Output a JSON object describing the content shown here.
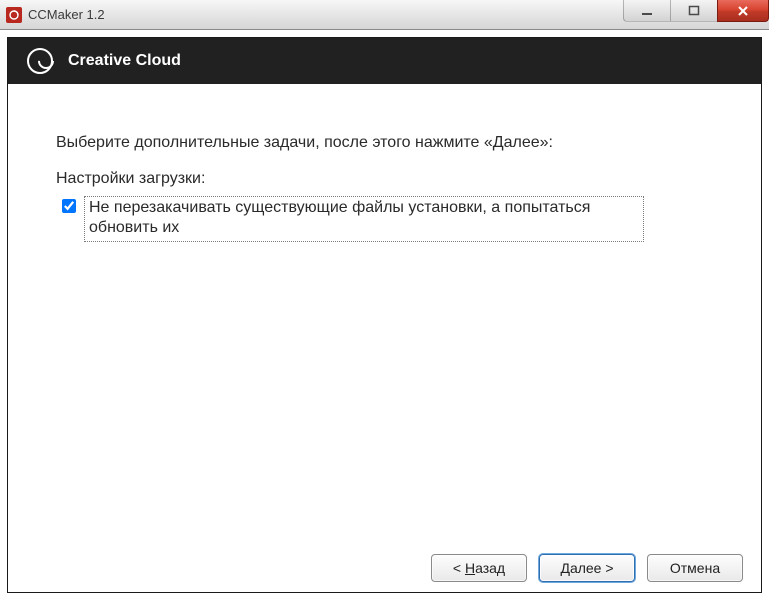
{
  "window": {
    "title": "CCMaker 1.2"
  },
  "banner": {
    "title": "Creative Cloud"
  },
  "content": {
    "instruction": "Выберите дополнительные задачи, после этого нажмите «Далее»:",
    "section_title": "Настройки загрузки:",
    "option1": {
      "checked": true,
      "label": "Не перезакачивать существующие файлы установки, а попытаться обновить их"
    }
  },
  "footer": {
    "back_prefix": "< ",
    "back_ul": "Н",
    "back_rest": "азад",
    "next_ul": "Д",
    "next_rest": "алее >",
    "cancel": "Отмена"
  }
}
